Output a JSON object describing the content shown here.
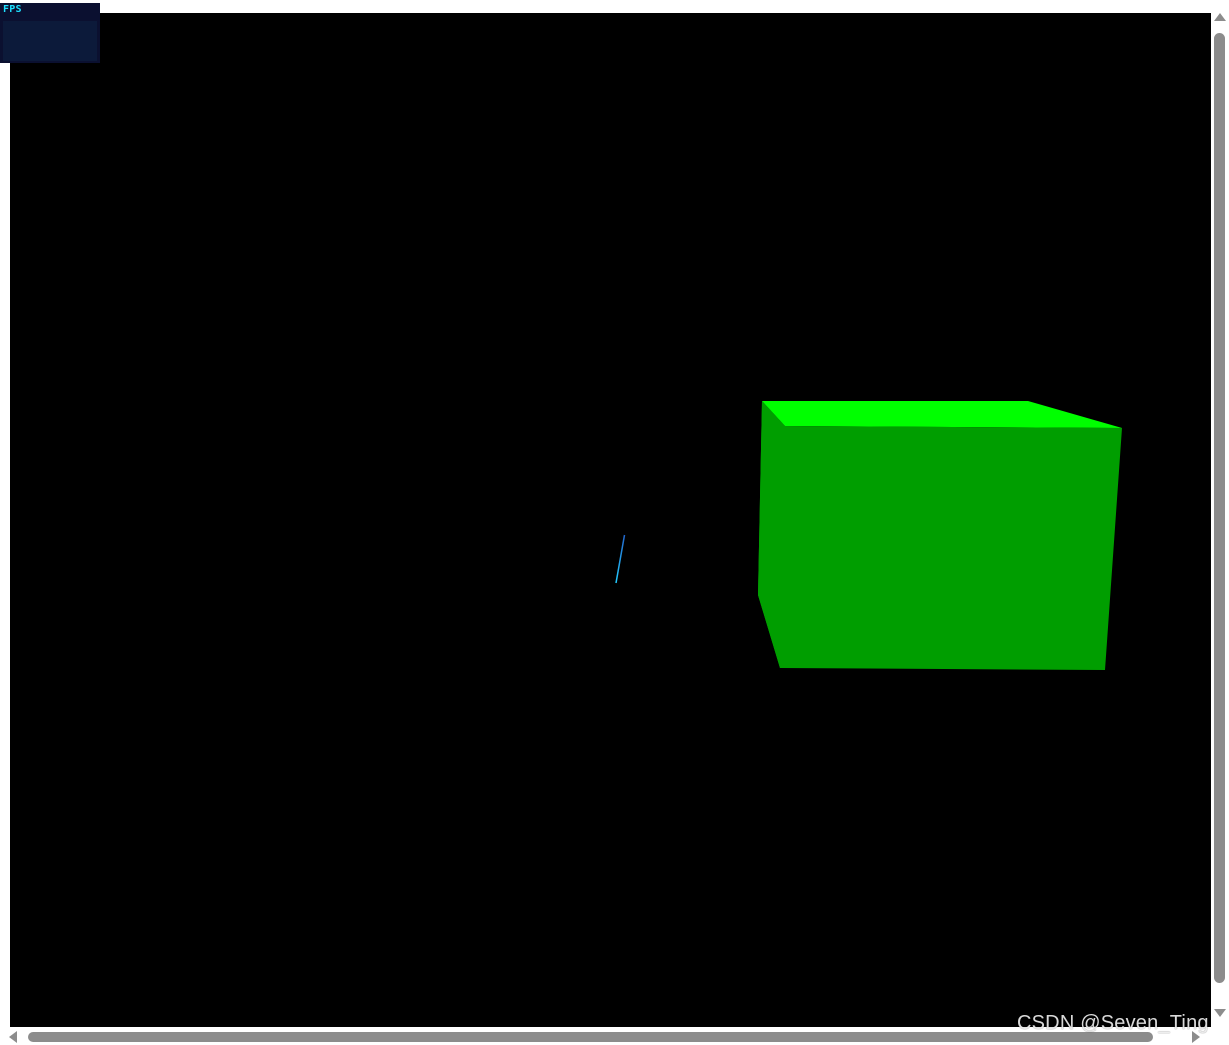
{
  "stats_panel": {
    "label": "FPS",
    "label_color": "#1ee0ff",
    "background_color": "#0b1030"
  },
  "scene": {
    "background_color": "#000000",
    "axes_helper": {
      "x_axis_color": "#ff6a00",
      "y_axis_color": "#c8ff00",
      "z_axis_color": "#1e90ff"
    },
    "cube": {
      "front_color": "#009e00",
      "top_color": "#00ff00",
      "side_color": "#00b400"
    }
  },
  "scrollbars": {
    "vertical": {
      "icon_up": "arrow-up-icon",
      "icon_down": "arrow-down-icon"
    },
    "horizontal": {
      "icon_left": "arrow-left-icon",
      "icon_right": "arrow-right-icon"
    }
  },
  "watermark": {
    "text": "CSDN @Seven_Ting"
  }
}
